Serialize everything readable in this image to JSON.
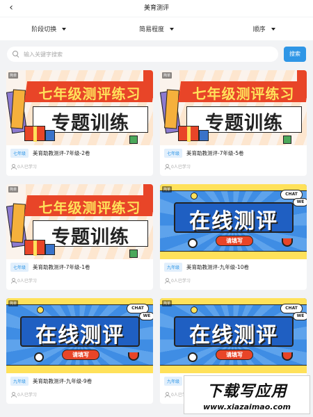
{
  "header": {
    "title": "美育测评",
    "back_icon": "chevron-left-icon"
  },
  "filters": [
    {
      "label": "阶段切换"
    },
    {
      "label": "简易程度"
    },
    {
      "label": "顺序"
    }
  ],
  "search": {
    "placeholder": "输入关键字搜索",
    "value": "",
    "button_label": "搜索"
  },
  "colors": {
    "accent": "#2f96e6",
    "banner_red": "#e84528",
    "banner_yellow": "#ffe15a",
    "banner_blue": "#3f8de4"
  },
  "cards": [
    {
      "banner": "grade7",
      "tag": "七年级",
      "title": "美育助教测评-7年级-2卷",
      "learners": "0人已学习",
      "banner_corner": "简单",
      "banner_head": "七年级测评练习",
      "banner_main": "专题训练"
    },
    {
      "banner": "grade7",
      "tag": "七年级",
      "title": "美育助教测评-7年级-5卷",
      "learners": "0人已学习",
      "banner_corner": "简单",
      "banner_head": "七年级测评练习",
      "banner_main": "专题训练"
    },
    {
      "banner": "grade7",
      "tag": "七年级",
      "title": "美育助教测评-7年级-1卷",
      "learners": "0人已学习",
      "banner_corner": "简单",
      "banner_head": "七年级测评练习",
      "banner_main": "专题训练"
    },
    {
      "banner": "online",
      "tag": "九年级",
      "title": "美育助教测评-九年级-10卷",
      "learners": "0人已学习",
      "banner_corner": "简单",
      "banner_main": "在线测评",
      "banner_pill": "请填写",
      "banner_bubble": "CHAT",
      "banner_bubble2": "WE"
    },
    {
      "banner": "online",
      "tag": "九年级",
      "title": "美育助教测评-九年级-9卷",
      "learners": "0人已学习",
      "banner_corner": "简单",
      "banner_main": "在线测评",
      "banner_pill": "请填写",
      "banner_bubble": "CHAT",
      "banner_bubble2": "WE"
    },
    {
      "banner": "online",
      "tag": "九年级",
      "title": "",
      "learners": "0人已学习",
      "banner_corner": "简单",
      "banner_main": "在线测评",
      "banner_pill": "请填写",
      "banner_bubble": "CHAT",
      "banner_bubble2": "WE"
    }
  ],
  "watermark": {
    "line1": "下载写应用",
    "line2": "www.xiazaimao.com"
  }
}
